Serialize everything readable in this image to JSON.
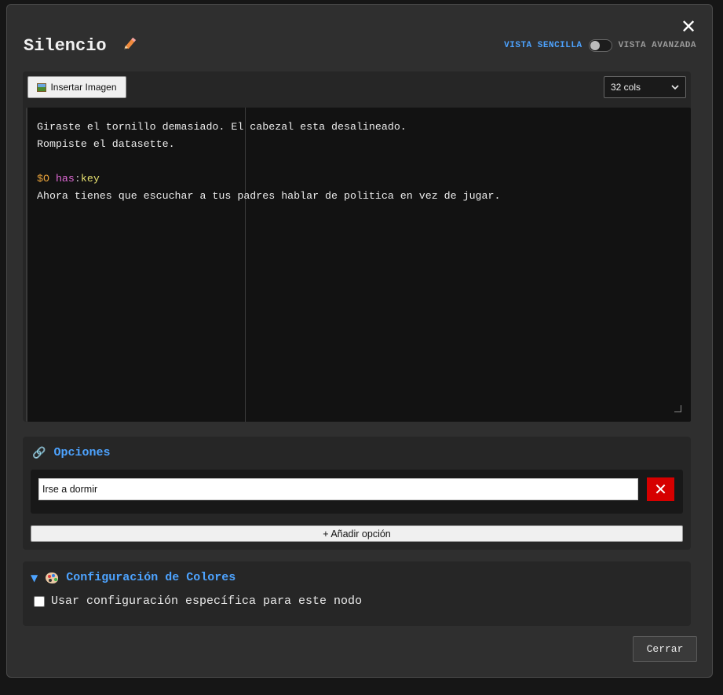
{
  "dialog": {
    "title": "Silencio",
    "close_symbol": "✕",
    "view_toggle": {
      "simple_label": "VISTA SENCILLA",
      "advanced_label": "VISTA AVANZADA",
      "state": "simple"
    }
  },
  "editor": {
    "insert_image_label": "Insertar Imagen",
    "cols_select": {
      "selected": "32 cols",
      "arrow": "⌄"
    },
    "lines": [
      "Giraste el tornillo demasiado. El cabezal esta desalineado.",
      "Rompiste el datasette.",
      ""
    ],
    "condition": {
      "var": "$O",
      "keyword": "has",
      "sep": ":",
      "value": "key"
    },
    "last_line": "Ahora tienes que escuchar a tus padres hablar de politica en vez de jugar."
  },
  "options": {
    "heading": "Opciones",
    "items": [
      {
        "value": "Irse a dormir"
      }
    ],
    "delete_symbol": "✕",
    "add_label": "+ Añadir opción"
  },
  "colors": {
    "caret": "▼",
    "heading": "Configuración de Colores",
    "checkbox_label": "Usar configuración específica para este nodo",
    "checked": false
  },
  "footer": {
    "close_label": "Cerrar"
  },
  "icons": {
    "link": "🔗",
    "pencil": "pencil-icon",
    "palette": "palette-icon",
    "image": "image-icon"
  }
}
